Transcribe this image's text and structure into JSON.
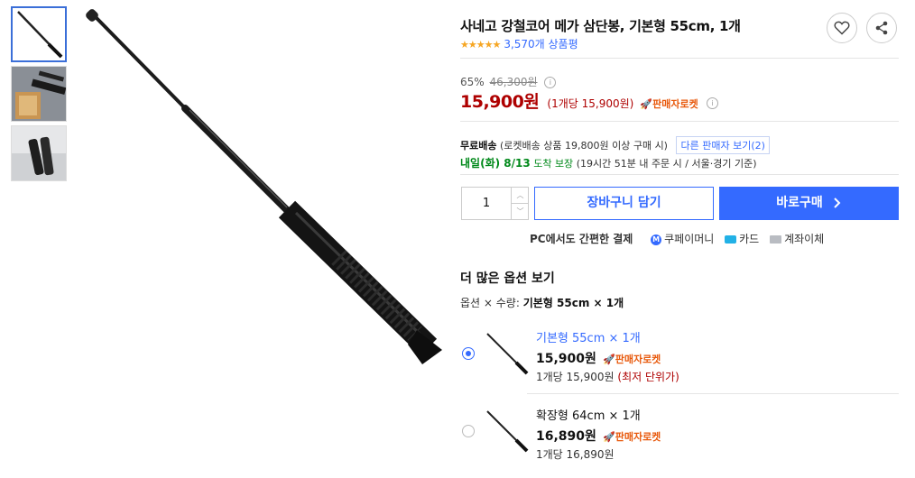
{
  "product": {
    "title": "사네고 강철코어 메가 삼단봉, 기본형 55cm, 1개",
    "stars": "★★★★★",
    "rating_value": 4.5,
    "review_count": "3,570개 상품평"
  },
  "price": {
    "discount_rate": "65%",
    "original": "46,300원",
    "current": "15,900원",
    "unit_price": "(1개당 15,900원)",
    "badge": "판매자로켓"
  },
  "shipping": {
    "free": "무료배송",
    "condition": "(로켓배송 상품 19,800원 이상 구매 시)",
    "other_sellers": "다른 판매자 보기(2)",
    "arrival": "내일(화) 8/13",
    "arrival_suffix": "도착 보장",
    "arrival_note": "(19시간 51분  내 주문 시 / 서울·경기 기준)"
  },
  "purchase": {
    "quantity": "1",
    "cart_label": "장바구니 담기",
    "buy_label": "바로구매"
  },
  "payment": {
    "label": "PC에서도 간편한 결제",
    "methods": [
      "쿠페이머니",
      "카드",
      "계좌이체"
    ]
  },
  "options": {
    "header": "더 많은 옵션 보기",
    "summary_prefix": "옵션 × 수량:",
    "summary_value": "기본형 55cm × 1개",
    "items": [
      {
        "name": "기본형 55cm × 1개",
        "price": "15,900원",
        "badge": "판매자로켓",
        "unit": "1개당 15,900원",
        "note": "(최저 단위가)",
        "selected": true
      },
      {
        "name": "확장형 64cm × 1개",
        "price": "16,890원",
        "badge": "판매자로켓",
        "unit": "1개당 16,890원",
        "note": "",
        "selected": false
      }
    ]
  },
  "colors": {
    "accent": "#346aff",
    "price": "#ae0000",
    "rocket": "#e8590c",
    "green": "#00891a",
    "star": "#f6a623"
  },
  "icons": [
    "heart-icon",
    "share-icon",
    "info-icon",
    "rocket-icon",
    "chevron-right-icon",
    "coupay-icon",
    "card-icon",
    "bank-icon"
  ]
}
